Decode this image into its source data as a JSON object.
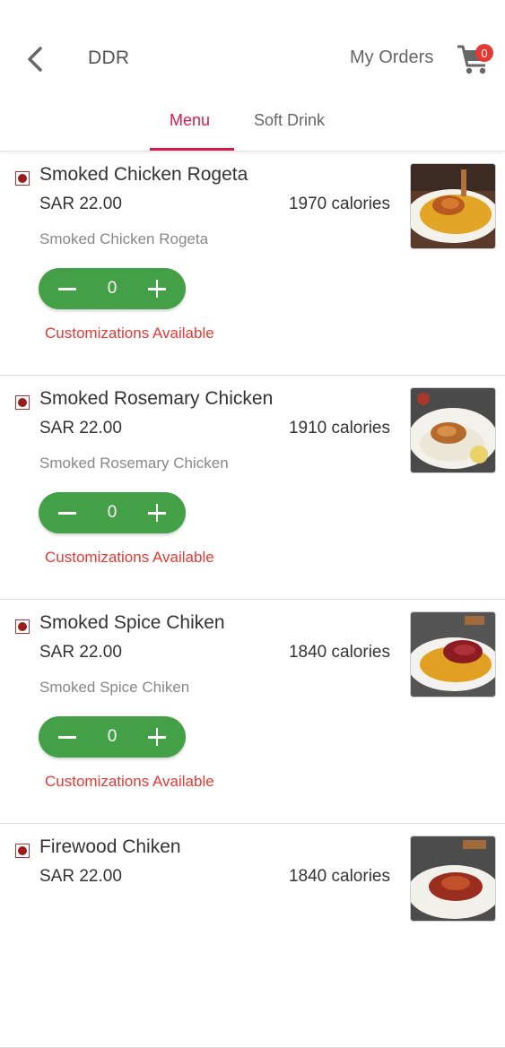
{
  "header": {
    "title": "DDR",
    "my_orders_label": "My Orders",
    "cart_count": "0",
    "back_icon": "chevron-left-icon",
    "cart_icon": "cart-icon"
  },
  "tabs": [
    {
      "label": "Menu",
      "active": true
    },
    {
      "label": "Soft Drink",
      "active": false
    }
  ],
  "colors": {
    "accent": "#d81b4a",
    "stepper_green": "#43a047",
    "badge_red": "#e53935",
    "customization_red": "#e53935"
  },
  "items": [
    {
      "name": "Smoked Chicken Rogeta",
      "price": "SAR 22.00",
      "calories": "1970 calories",
      "description": "Smoked Chicken Rogeta",
      "quantity": "0",
      "customization": "Customizations Available"
    },
    {
      "name": "Smoked Rosemary Chicken",
      "price": "SAR 22.00",
      "calories": "1910 calories",
      "description": "Smoked Rosemary Chicken",
      "quantity": "0",
      "customization": "Customizations Available"
    },
    {
      "name": "Smoked Spice Chiken",
      "price": "SAR 22.00",
      "calories": "1840 calories",
      "description": "Smoked Spice Chiken",
      "quantity": "0",
      "customization": "Customizations Available"
    },
    {
      "name": "Firewood Chiken",
      "price": "SAR 22.00",
      "calories": "1840 calories",
      "description": "",
      "quantity": "",
      "customization": ""
    }
  ]
}
